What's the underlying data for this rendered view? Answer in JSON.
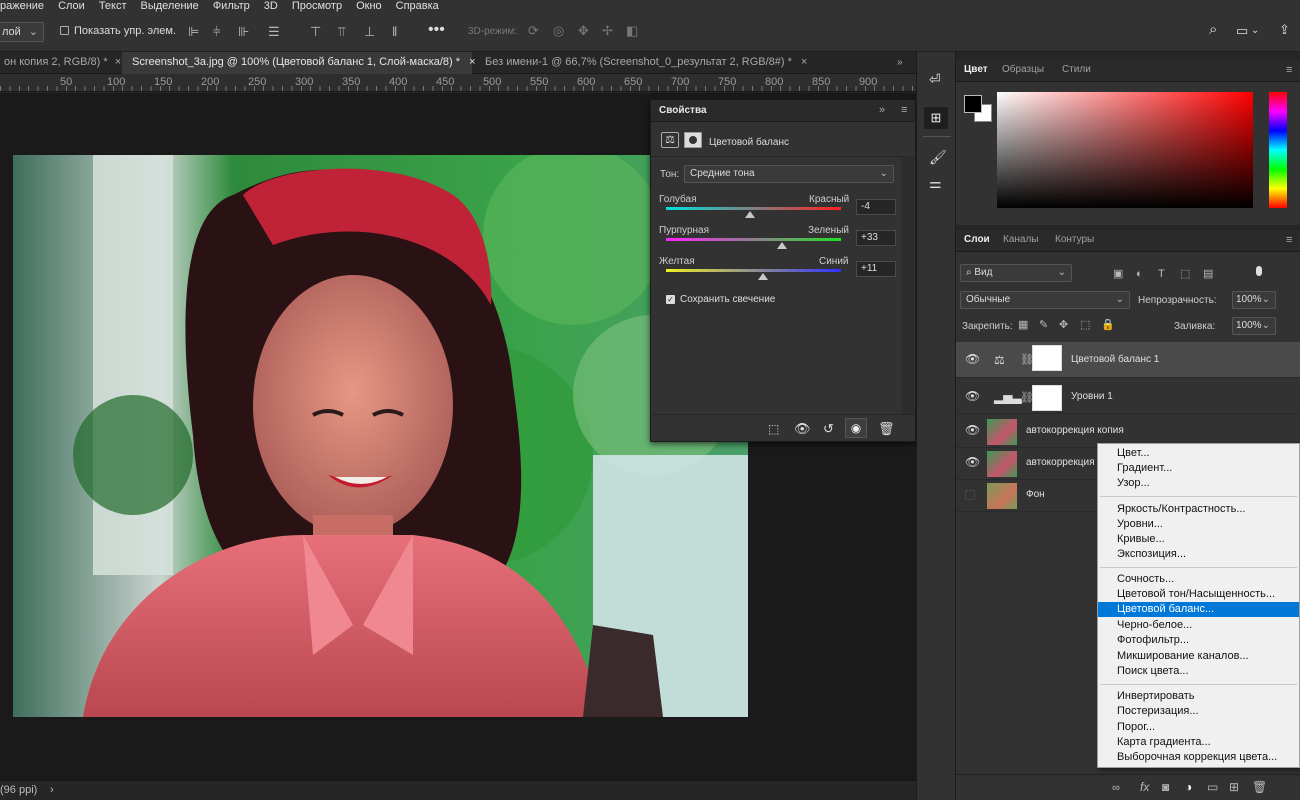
{
  "menubar": {
    "items": [
      "ражение",
      "Слои",
      "Текст",
      "Выделение",
      "Фильтр",
      "3D",
      "Просмотр",
      "Окно",
      "Справка"
    ]
  },
  "options": {
    "layer_select": "лой",
    "show_controls_label": "Показать упр. элем.",
    "mode3d_label": "3D-режим:"
  },
  "tabs": [
    {
      "label": "он копия 2, RGB/8) *",
      "close": "×"
    },
    {
      "label": "Screenshot_3a.jpg @ 100% (Цветовой баланс 1, Слой-маска/8) *",
      "close": "×"
    },
    {
      "label": "Без имени-1 @ 66,7% (Screenshot_0_результат 2, RGB/8#) *",
      "close": "×"
    }
  ],
  "ruler": {
    "labels": [
      "50",
      "100",
      "150",
      "200",
      "250",
      "300",
      "350",
      "400",
      "450",
      "500",
      "550",
      "600",
      "650",
      "700",
      "750",
      "800",
      "850",
      "900"
    ]
  },
  "status": {
    "text": "(96 ppi)",
    "arrow": "›"
  },
  "properties": {
    "title": "Свойства",
    "panel_name": "Цветовой баланс",
    "tone_label": "Тон:",
    "tone_value": "Средние тона",
    "sliders": [
      {
        "left": "Голубая",
        "right": "Красный",
        "value": "-4",
        "level": -4
      },
      {
        "left": "Пурпурная",
        "right": "Зеленый",
        "value": "+33",
        "level": 33
      },
      {
        "left": "Желтая",
        "right": "Синий",
        "value": "+11",
        "level": 11
      }
    ],
    "preserve_label": "Сохранить свечение",
    "preserve_checked": true
  },
  "color": {
    "tabs": [
      "Цвет",
      "Образцы",
      "Стили"
    ],
    "fg": "#000000",
    "bg": "#ffffff"
  },
  "layers": {
    "tabs": [
      "Слои",
      "Каналы",
      "Контуры"
    ],
    "filter_value": "Вид",
    "blend_mode": "Обычные",
    "opacity_label": "Непрозрачность:",
    "opacity_value": "100%",
    "lock_label": "Закрепить:",
    "fill_label": "Заливка:",
    "fill_value": "100%",
    "rows": [
      {
        "name": "Цветовой баланс 1",
        "visible": true,
        "selected": true,
        "kind": "balance"
      },
      {
        "name": "Уровни 1",
        "visible": true,
        "selected": false,
        "kind": "levels"
      },
      {
        "name": "автокоррекция копия",
        "visible": true,
        "selected": false,
        "kind": "image"
      },
      {
        "name": "автокоррекция",
        "visible": true,
        "selected": false,
        "kind": "image"
      },
      {
        "name": "Фон",
        "visible": false,
        "selected": false,
        "kind": "image"
      }
    ]
  },
  "menu": {
    "groups": [
      [
        "Цвет...",
        "Градиент...",
        "Узор..."
      ],
      [
        "Яркость/Контрастность...",
        "Уровни...",
        "Кривые...",
        "Экспозиция..."
      ],
      [
        "Сочность...",
        "Цветовой тон/Насыщенность...",
        "Цветовой баланс...",
        "Черно-белое...",
        "Фотофильтр...",
        "Микширование каналов...",
        "Поиск цвета..."
      ],
      [
        "Инвертировать",
        "Постеризация...",
        "Порог...",
        "Карта градиента...",
        "Выборочная коррекция цвета..."
      ]
    ],
    "highlighted": "Цветовой баланс..."
  }
}
